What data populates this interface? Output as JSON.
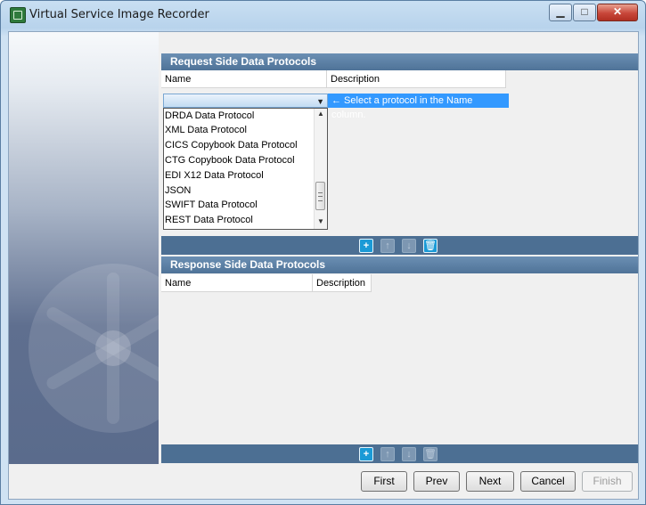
{
  "window": {
    "title": "Virtual Service Image Recorder",
    "minimize_glyph": "▁",
    "maximize_glyph": "□",
    "close_glyph": "✕"
  },
  "request_section": {
    "title": "Request Side Data Protocols",
    "columns": [
      "Name",
      "Description"
    ],
    "combo_value": "",
    "hint": "← Select a protocol in the Name column.",
    "dropdown_items": [
      "DRDA Data Protocol",
      "XML Data Protocol",
      "CICS Copybook Data Protocol",
      "CTG Copybook Data Protocol",
      "EDI X12 Data Protocol",
      "JSON",
      "SWIFT Data Protocol",
      "REST Data Protocol"
    ]
  },
  "toolbar_icons": {
    "add": "+",
    "up": "↑",
    "down": "↓",
    "delete": "🗑"
  },
  "response_section": {
    "title": "Response Side Data Protocols",
    "columns": [
      "Name",
      "Description"
    ]
  },
  "footer": {
    "first": "First",
    "prev": "Prev",
    "next": "Next",
    "cancel": "Cancel",
    "finish": "Finish"
  },
  "colors": {
    "header_blue": "#4f7398",
    "selection_blue": "#3399ff"
  }
}
